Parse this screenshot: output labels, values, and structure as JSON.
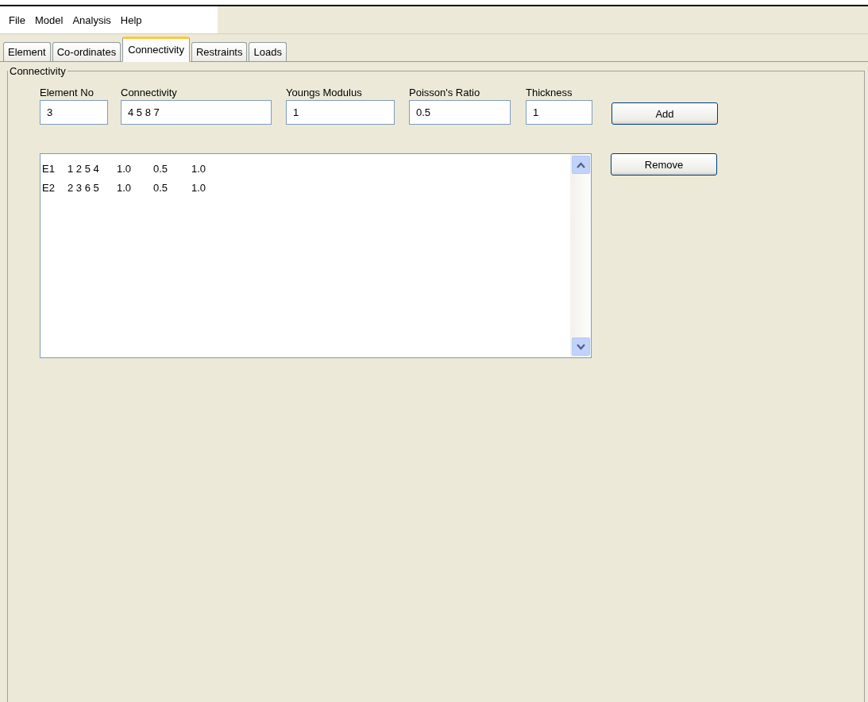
{
  "menu": [
    "File",
    "Model",
    "Analysis",
    "Help"
  ],
  "tabs": [
    {
      "label": "Element",
      "selected": false
    },
    {
      "label": "Co-ordinates",
      "selected": false
    },
    {
      "label": "Connectivity",
      "selected": true
    },
    {
      "label": "Restraints",
      "selected": false
    },
    {
      "label": "Loads",
      "selected": false
    }
  ],
  "group": {
    "title": "Connectivity",
    "fields": [
      {
        "label": "Element No",
        "value": "3"
      },
      {
        "label": "Connectivity",
        "value": "4 5 8 7"
      },
      {
        "label": "Youngs Modulus",
        "value": "1"
      },
      {
        "label": "Poisson's Ratio",
        "value": "0.5"
      },
      {
        "label": "Thickness",
        "value": "1"
      }
    ],
    "add_button": "Add",
    "remove_button": "Remove",
    "list": [
      [
        "E1",
        "1 2 5 4",
        "1.0",
        "0.5",
        "1.0"
      ],
      [
        "E2",
        "2 3 6 5",
        "1.0",
        "0.5",
        "1.0"
      ]
    ]
  }
}
